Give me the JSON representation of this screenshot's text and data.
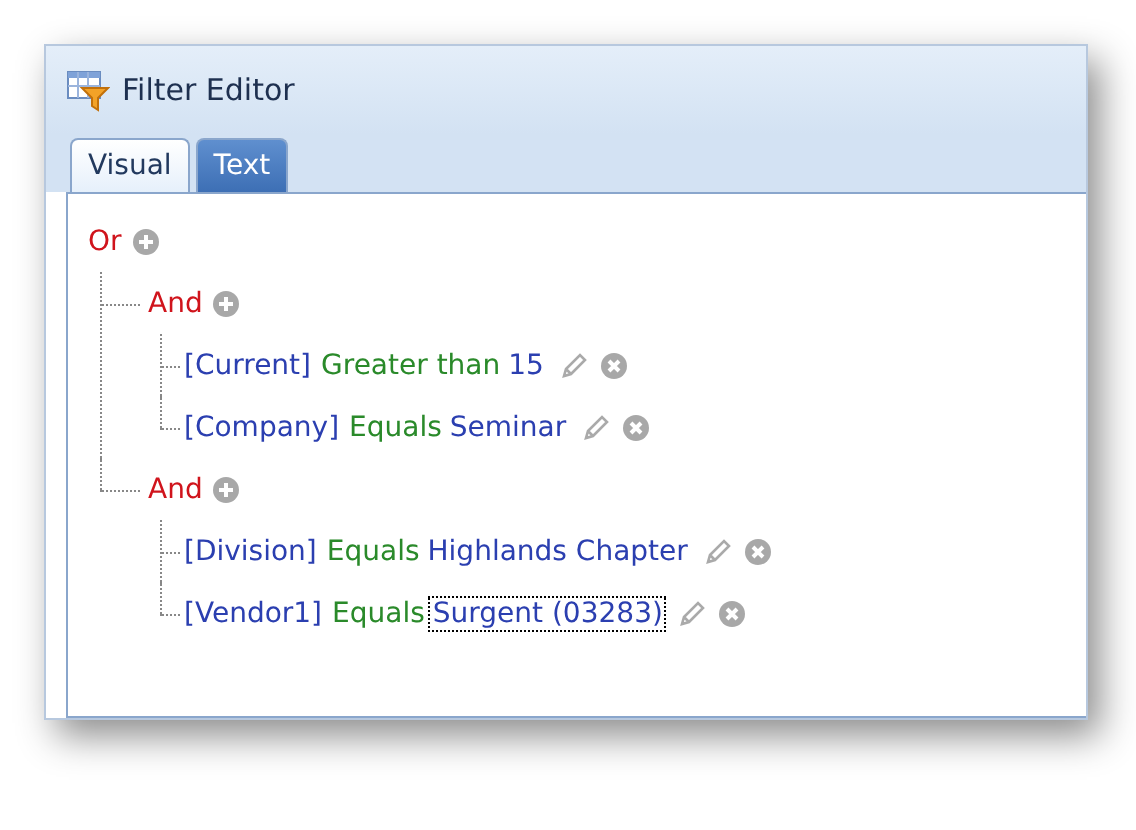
{
  "window": {
    "title": "Filter Editor"
  },
  "tabs": [
    {
      "label": "Visual",
      "selected": true
    },
    {
      "label": "Text",
      "selected": false
    }
  ],
  "tree": {
    "kind": "group",
    "operator": "Or",
    "children": [
      {
        "kind": "group",
        "operator": "And",
        "children": [
          {
            "kind": "condition",
            "field": "[Current]",
            "operator": "Greater than",
            "value": "15",
            "focused": false
          },
          {
            "kind": "condition",
            "field": "[Company]",
            "operator": "Equals",
            "value": "Seminar",
            "focused": false
          }
        ]
      },
      {
        "kind": "group",
        "operator": "And",
        "children": [
          {
            "kind": "condition",
            "field": "[Division]",
            "operator": "Equals",
            "value": "Highlands Chapter",
            "focused": false
          },
          {
            "kind": "condition",
            "field": "[Vendor1]",
            "operator": "Equals",
            "value": "Surgent (03283)",
            "focused": true
          }
        ]
      }
    ]
  }
}
